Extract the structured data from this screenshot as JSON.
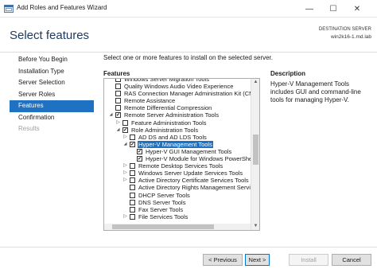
{
  "window": {
    "title": "Add Roles and Features Wizard",
    "minimize_glyph": "—",
    "maximize_glyph": "☐",
    "close_glyph": "✕"
  },
  "header": {
    "page_title": "Select features",
    "destination_label": "DESTINATION SERVER",
    "destination_value": "win2k16-1.md.lab"
  },
  "nav": {
    "items": [
      {
        "label": "Before You Begin",
        "state": "normal"
      },
      {
        "label": "Installation Type",
        "state": "normal"
      },
      {
        "label": "Server Selection",
        "state": "normal"
      },
      {
        "label": "Server Roles",
        "state": "normal"
      },
      {
        "label": "Features",
        "state": "active"
      },
      {
        "label": "Confirmation",
        "state": "normal"
      },
      {
        "label": "Results",
        "state": "disabled"
      }
    ]
  },
  "main": {
    "instructions": "Select one or more features to install on the selected server.",
    "features_label": "Features",
    "description_label": "Description",
    "description_text": "Hyper-V Management Tools includes GUI and command-line tools for managing Hyper-V."
  },
  "tree": {
    "rows": [
      {
        "label": "Windows Server Migration Tools",
        "checked": false,
        "expander": "none",
        "level": 0,
        "selected": false
      },
      {
        "label": "Quality Windows Audio Video Experience",
        "checked": false,
        "expander": "none",
        "level": 0,
        "selected": false
      },
      {
        "label": "RAS Connection Manager Administration Kit (CMAK)",
        "checked": false,
        "expander": "none",
        "level": 0,
        "selected": false
      },
      {
        "label": "Remote Assistance",
        "checked": false,
        "expander": "none",
        "level": 0,
        "selected": false
      },
      {
        "label": "Remote Differential Compression",
        "checked": false,
        "expander": "none",
        "level": 0,
        "selected": false
      },
      {
        "label": "Remote Server Administration Tools",
        "checked": true,
        "expander": "expanded",
        "level": 0,
        "selected": false
      },
      {
        "label": "Feature Administration Tools",
        "checked": false,
        "expander": "collapsed",
        "level": 1,
        "selected": false
      },
      {
        "label": "Role Administration Tools",
        "checked": true,
        "expander": "expanded",
        "level": 1,
        "selected": false
      },
      {
        "label": "AD DS and AD LDS Tools",
        "checked": false,
        "expander": "collapsed",
        "level": 2,
        "selected": false
      },
      {
        "label": "Hyper-V Management Tools",
        "checked": true,
        "expander": "expanded",
        "level": 2,
        "selected": true
      },
      {
        "label": "Hyper-V GUI Management Tools",
        "checked": true,
        "expander": "none",
        "level": 3,
        "selected": false
      },
      {
        "label": "Hyper-V Module for Windows PowerShell",
        "checked": true,
        "expander": "none",
        "level": 3,
        "selected": false
      },
      {
        "label": "Remote Desktop Services Tools",
        "checked": false,
        "expander": "collapsed",
        "level": 2,
        "selected": false
      },
      {
        "label": "Windows Server Update Services Tools",
        "checked": false,
        "expander": "collapsed",
        "level": 2,
        "selected": false
      },
      {
        "label": "Active Directory Certificate Services Tools",
        "checked": false,
        "expander": "collapsed",
        "level": 2,
        "selected": false
      },
      {
        "label": "Active Directory Rights Management Services",
        "checked": false,
        "expander": "none",
        "level": 2,
        "selected": false
      },
      {
        "label": "DHCP Server Tools",
        "checked": false,
        "expander": "none",
        "level": 2,
        "selected": false
      },
      {
        "label": "DNS Server Tools",
        "checked": false,
        "expander": "none",
        "level": 2,
        "selected": false
      },
      {
        "label": "Fax Server Tools",
        "checked": false,
        "expander": "none",
        "level": 2,
        "selected": false
      },
      {
        "label": "File Services Tools",
        "checked": false,
        "expander": "collapsed",
        "level": 2,
        "selected": false
      }
    ]
  },
  "footer": {
    "previous_label": "< Previous",
    "next_label": "Next >",
    "install_label": "Install",
    "cancel_label": "Cancel"
  },
  "colors": {
    "accent": "#1f71c2",
    "title_blue": "#1e395b"
  }
}
